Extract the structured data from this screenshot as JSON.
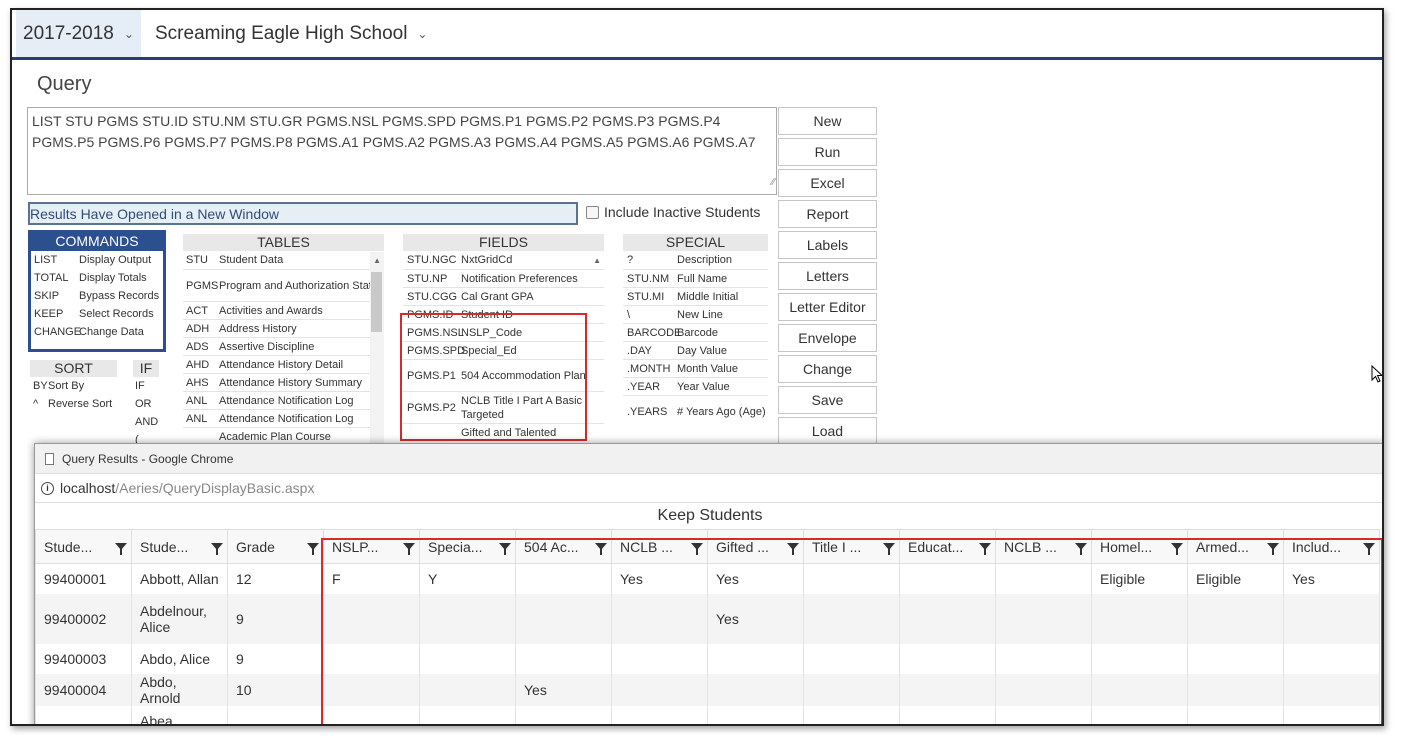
{
  "header": {
    "year": "2017-2018",
    "school": "Screaming Eagle High School"
  },
  "page_title": "Query",
  "query_text": "LIST STU PGMS STU.ID STU.NM STU.GR PGMS.NSL PGMS.SPD PGMS.P1 PGMS.P2 PGMS.P3 PGMS.P4 PGMS.P5 PGMS.P6 PGMS.P7 PGMS.P8 PGMS.A1 PGMS.A2 PGMS.A3 PGMS.A4 PGMS.A5 PGMS.A6 PGMS.A7",
  "buttons": [
    "New",
    "Run",
    "Excel",
    "Report",
    "Labels",
    "Letters",
    "Letter Editor",
    "Envelope",
    "Change",
    "Save",
    "Load"
  ],
  "status_message": "Results Have Opened in a New Window",
  "include_inactive_label": "Include Inactive Students",
  "commands": {
    "title": "COMMANDS",
    "items": [
      {
        "k": "LIST",
        "v": "Display Output"
      },
      {
        "k": "TOTAL",
        "v": "Display Totals"
      },
      {
        "k": "SKIP",
        "v": "Bypass Records"
      },
      {
        "k": "KEEP",
        "v": "Select Records"
      },
      {
        "k": "CHANGE",
        "v": "Change Data"
      }
    ]
  },
  "tables": {
    "title": "TABLES",
    "items": [
      {
        "k": "STU",
        "v": "Student Data"
      },
      {
        "k": "PGMS",
        "v": "Program and Authorization Status"
      },
      {
        "k": "ACT",
        "v": "Activities and Awards"
      },
      {
        "k": "ADH",
        "v": "Address History"
      },
      {
        "k": "ADS",
        "v": "Assertive Discipline"
      },
      {
        "k": "AHD",
        "v": "Attendance History Detail"
      },
      {
        "k": "AHS",
        "v": "Attendance History Summary"
      },
      {
        "k": "ANL",
        "v": "Attendance Notification Log"
      },
      {
        "k": "ANL",
        "v": "Attendance Notification Log"
      },
      {
        "k": "",
        "v": "Academic Plan Course"
      }
    ]
  },
  "fields": {
    "title": "FIELDS",
    "items": [
      {
        "k": "STU.NGC",
        "v": "NxtGridCd"
      },
      {
        "k": "STU.NP",
        "v": "Notification Preferences"
      },
      {
        "k": "STU.CGG",
        "v": "Cal Grant GPA"
      },
      {
        "k": "PGMS.ID",
        "v": "Student ID"
      },
      {
        "k": "PGMS.NSL",
        "v": "NSLP_Code"
      },
      {
        "k": "PGMS.SPD",
        "v": "Special_Ed"
      },
      {
        "k": "PGMS.P1",
        "v": "504 Accommodation Plan"
      },
      {
        "k": "PGMS.P2",
        "v": "NCLB Title I Part A Basic Targeted"
      },
      {
        "k": "",
        "v": "Gifted and Talented"
      }
    ]
  },
  "special": {
    "title": "SPECIAL",
    "items": [
      {
        "k": "?",
        "v": "Description"
      },
      {
        "k": "STU.NM",
        "v": "Full Name"
      },
      {
        "k": "STU.MI",
        "v": "Middle Initial"
      },
      {
        "k": "\\",
        "v": "New Line"
      },
      {
        "k": "BARCODE",
        "v": "Barcode"
      },
      {
        "k": ".DAY",
        "v": "Day Value"
      },
      {
        "k": ".MONTH",
        "v": "Month Value"
      },
      {
        "k": ".YEAR",
        "v": "Year Value"
      },
      {
        "k": ".YEARS",
        "v": "# Years Ago (Age)"
      }
    ]
  },
  "sort": {
    "title": "SORT",
    "items": [
      {
        "k": "BY",
        "v": "Sort By"
      },
      {
        "k": "^",
        "v": "Reverse Sort"
      }
    ]
  },
  "if_panel": {
    "title": "IF",
    "items": [
      "IF",
      "OR",
      "AND",
      "("
    ]
  },
  "popup": {
    "window_title": "Query Results - Google Chrome",
    "url_host": "localhost",
    "url_path": "/Aeries/QueryDisplayBasic.aspx",
    "caption": "Keep Students",
    "columns": [
      "Stude...",
      "Stude...",
      "Grade",
      "NSLP...",
      "Specia...",
      "504 Ac...",
      "NCLB ...",
      "Gifted ...",
      "Title I ...",
      "Educat...",
      "NCLB ...",
      "Homel...",
      "Armed...",
      "Includ..."
    ],
    "rows": [
      [
        "99400001",
        "Abbott, Allan",
        "12",
        "F",
        "Y",
        "",
        "Yes",
        "Yes",
        "",
        "",
        "",
        "Eligible",
        "Eligible",
        "Yes"
      ],
      [
        "99400002",
        "Abdelnour, Alice",
        "9",
        "",
        "",
        "",
        "",
        "Yes",
        "",
        "",
        "",
        "",
        "",
        ""
      ],
      [
        "99400003",
        "Abdo, Alice",
        "9",
        "",
        "",
        "",
        "",
        "",
        "",
        "",
        "",
        "",
        "",
        ""
      ],
      [
        "99400004",
        "Abdo, Arnold",
        "10",
        "",
        "",
        "Yes",
        "",
        "",
        "",
        "",
        "",
        "",
        "",
        ""
      ],
      [
        "",
        "Abea",
        "",
        "",
        "",
        "",
        "",
        "",
        "",
        "",
        "",
        "",
        "",
        ""
      ]
    ]
  }
}
